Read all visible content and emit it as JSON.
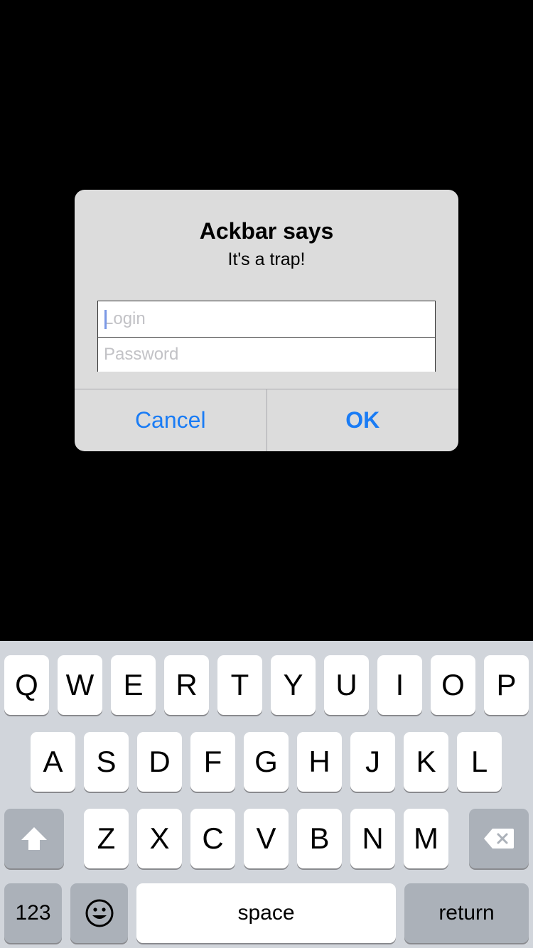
{
  "alert": {
    "title": "Ackbar says",
    "message": "It's a trap!",
    "login_placeholder": "Login",
    "password_placeholder": "Password",
    "cancel_label": "Cancel",
    "ok_label": "OK"
  },
  "keyboard": {
    "row1": [
      "Q",
      "W",
      "E",
      "R",
      "T",
      "Y",
      "U",
      "I",
      "O",
      "P"
    ],
    "row2": [
      "A",
      "S",
      "D",
      "F",
      "G",
      "H",
      "J",
      "K",
      "L"
    ],
    "row3": [
      "Z",
      "X",
      "C",
      "V",
      "B",
      "N",
      "M"
    ],
    "numbers_label": "123",
    "space_label": "space",
    "return_label": "return",
    "shift_icon": "shift-icon",
    "delete_icon": "delete-icon",
    "emoji_icon": "emoji-icon"
  },
  "colors": {
    "accent": "#1a7cf5",
    "alert_bg": "#dcdcdc",
    "keyboard_bg": "#d1d5db",
    "dark_key": "#abb1b9"
  }
}
